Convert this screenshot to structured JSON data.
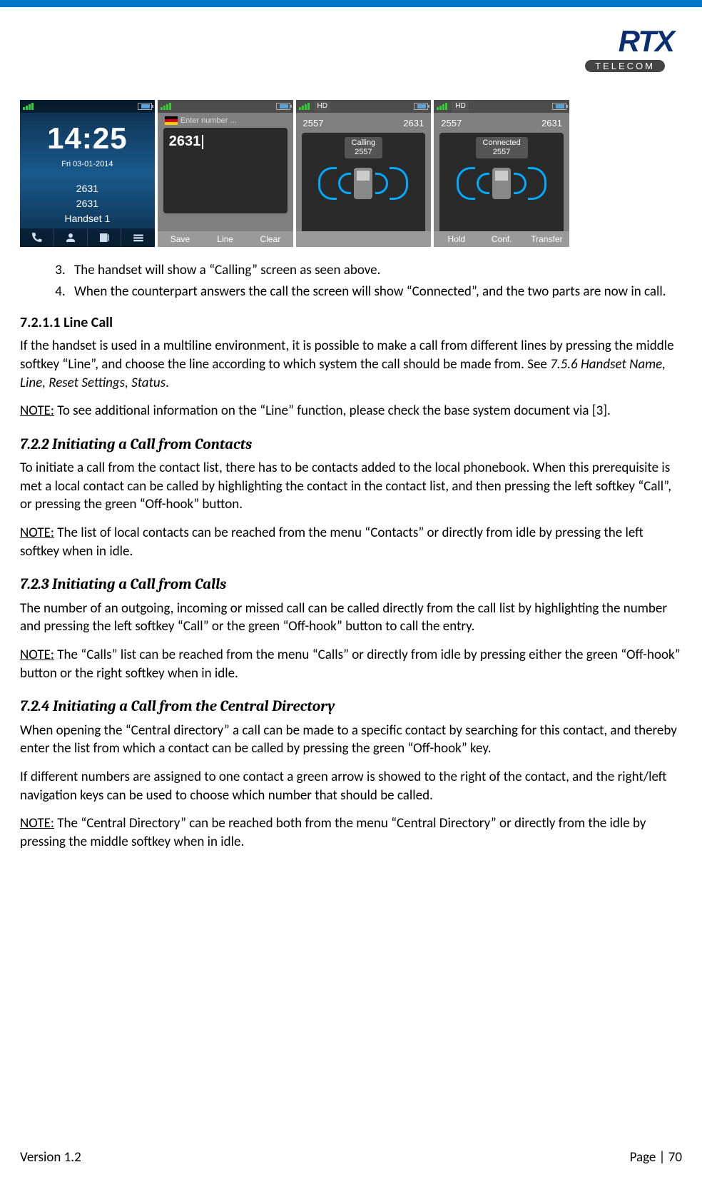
{
  "logo": {
    "brand": "RTX",
    "sub": "TELECOM"
  },
  "screens": {
    "idle": {
      "clock": "14:25",
      "date": "Fri 03-01-2014",
      "line1": "2631",
      "line2": "2631",
      "name": "Handset 1"
    },
    "dial": {
      "enter": "Enter number ...",
      "number": "2631",
      "soft1": "Save",
      "soft2": "Line",
      "soft3": "Clear"
    },
    "calling": {
      "left": "2557",
      "right": "2631",
      "label1": "Calling",
      "label2": "2557"
    },
    "connected": {
      "left": "2557",
      "right": "2631",
      "label1": "Connected",
      "label2": "2557",
      "soft1": "Hold",
      "soft2": "Conf.",
      "soft3": "Transfer"
    },
    "hd": "HD"
  },
  "steps": {
    "s3": "The handset will show a “Calling” screen as seen above.",
    "s4": "When the counterpart answers the call the screen will show “Connected”, and the two parts are now in call."
  },
  "sec_line": {
    "h": "7.2.1.1 Line Call",
    "p1a": "If the handset is used in a multiline environment, it is possible to make a call from different lines by pressing the middle softkey “Line”, and choose the line according to which system the call should be made from. See ",
    "p1ref": "7.5.6 Handset Name, Line, Reset Settings, Status",
    "p1b": ".",
    "note": "NOTE:",
    "p2": " To see additional information on the “Line” function, please check the base system document via [3]."
  },
  "sec_contacts": {
    "h": "7.2.2 Initiating a Call from Contacts",
    "p1": "To initiate a call from the contact list, there has to be contacts added to the local phonebook. When this prerequisite is met a local contact can be called by highlighting the contact in the contact list, and then pressing the left softkey “Call”, or pressing the green “Off-hook” button.",
    "note": "NOTE:",
    "p2": " The list of local contacts can be reached from the menu “Contacts” or directly from idle by pressing the left softkey when in idle."
  },
  "sec_calls": {
    "h": "7.2.3 Initiating a Call from Calls",
    "p1": "The number of an outgoing, incoming or missed call can be called directly from the call list by highlighting the number and pressing the left softkey “Call” or the green “Off-hook” button to call the entry.",
    "note": "NOTE:",
    "p2": " The “Calls” list can be reached from the menu “Calls” or directly from idle by pressing either the green “Off-hook” button or the right softkey when in idle."
  },
  "sec_centdir": {
    "h": "7.2.4 Initiating a Call from the Central Directory",
    "p1": "When opening the “Central directory” a call can be made to a specific contact by searching for this contact, and thereby enter the list from which a contact can be called by pressing the green “Off-hook” key.",
    "p2": "If different numbers are assigned to one contact a green arrow is showed to the right of the contact, and the right/left navigation keys can be used to choose which number that should be called.",
    "note": "NOTE:",
    "p3": " The “Central Directory” can be reached both from the menu “Central Directory” or directly from the idle by pressing the middle softkey when in idle."
  },
  "footer": {
    "version": "Version 1.2",
    "page": "Page | 70"
  }
}
